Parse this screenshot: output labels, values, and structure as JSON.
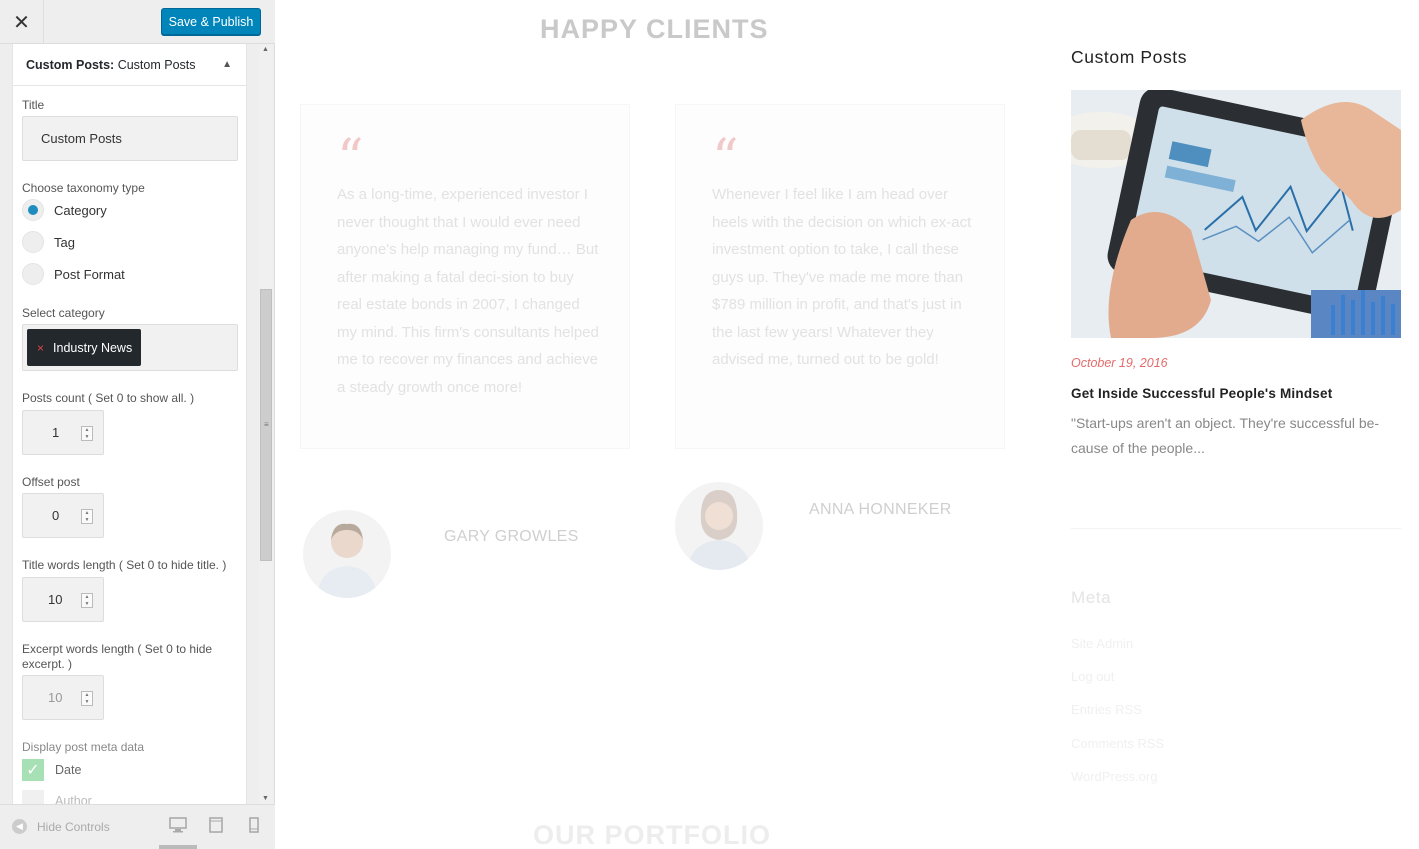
{
  "customizer": {
    "close_glyph": "✕",
    "save_label": "Save & Publish",
    "section_prefix": "Custom Posts:",
    "section_name": "Custom Posts",
    "title_label": "Title",
    "title_value": "Custom Posts",
    "taxonomy_label": "Choose taxonomy type",
    "taxonomy_options": [
      "Category",
      "Tag",
      "Post Format"
    ],
    "taxonomy_selected": "Category",
    "category_label": "Select category",
    "category_tag": "Industry News",
    "category_remove_glyph": "×",
    "posts_count_label": "Posts count ( Set 0 to show all. )",
    "posts_count_value": "1",
    "offset_label": "Offset post",
    "offset_value": "0",
    "title_words_label": "Title words length ( Set 0 to hide title. )",
    "title_words_value": "10",
    "excerpt_words_label": "Excerpt words length ( Set 0 to hide excerpt. )",
    "excerpt_words_value": "10",
    "meta_label": "Display post meta data",
    "meta_options": [
      {
        "label": "Date",
        "checked": true
      },
      {
        "label": "Author",
        "checked": false
      }
    ],
    "hide_controls_label": "Hide Controls",
    "devices": [
      "desktop-icon",
      "tablet-icon",
      "mobile-icon"
    ]
  },
  "preview": {
    "section_title": "HAPPY CLIENTS",
    "testimonials": [
      {
        "quote_mark": "“",
        "text": "As a long-time, experienced investor I never thought that I would ever need anyone's help managing my fund… But after making a fatal deci-sion to buy real estate bonds in 2007, I changed my mind. This firm's consultants helped me to recover my finances and achieve a steady growth once more!",
        "name": "GARY GROWLES"
      },
      {
        "quote_mark": "“",
        "text": "Whenever I feel like I am head over heels with the decision on which ex-act investment option to take, I call these guys up. They've made me more than $789 million in profit, and that's just in the last few years! Whatever they advised me, turned out to be gold!",
        "name": "ANNA HONNEKER"
      }
    ],
    "portfolio_title": "OUR PORTFOLIO",
    "widget_title": "Custom Posts",
    "post": {
      "date": "October 19, 2016",
      "title": "Get Inside Successful People's Mindset",
      "excerpt": "\"Start-ups aren't an object. They're successful be-cause of the people..."
    },
    "meta_title": "Meta",
    "meta_links": [
      "Site Admin",
      "Log out",
      "Entries RSS",
      "Comments RSS",
      "WordPress.org"
    ]
  },
  "colors": {
    "save_button": "#0085ba",
    "radio_selected": "#1e8cbe",
    "tag_bg": "#23282d",
    "checkbox_checked": "#a7e0b4",
    "post_date": "#e36b6b"
  }
}
